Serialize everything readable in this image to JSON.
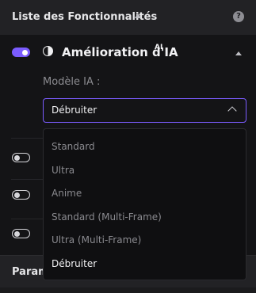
{
  "header": {
    "title": "Liste des Fonctionnalités",
    "help": "?"
  },
  "feature": {
    "title": "Amélioration d'IA",
    "superscript": "AI",
    "enabled": true,
    "model_label": "Modèle IA :",
    "selected_model": "Débruiter",
    "options": [
      "Standard",
      "Ultra",
      "Anime",
      "Standard (Multi-Frame)",
      "Ultra (Multi-Frame)",
      "Débruiter"
    ]
  },
  "other_toggles": [
    false,
    false,
    false
  ],
  "footer": {
    "title": "Paramètres"
  },
  "colors": {
    "accent": "#7b5cff",
    "panel_bg": "#141416",
    "header_bg": "#222225"
  }
}
